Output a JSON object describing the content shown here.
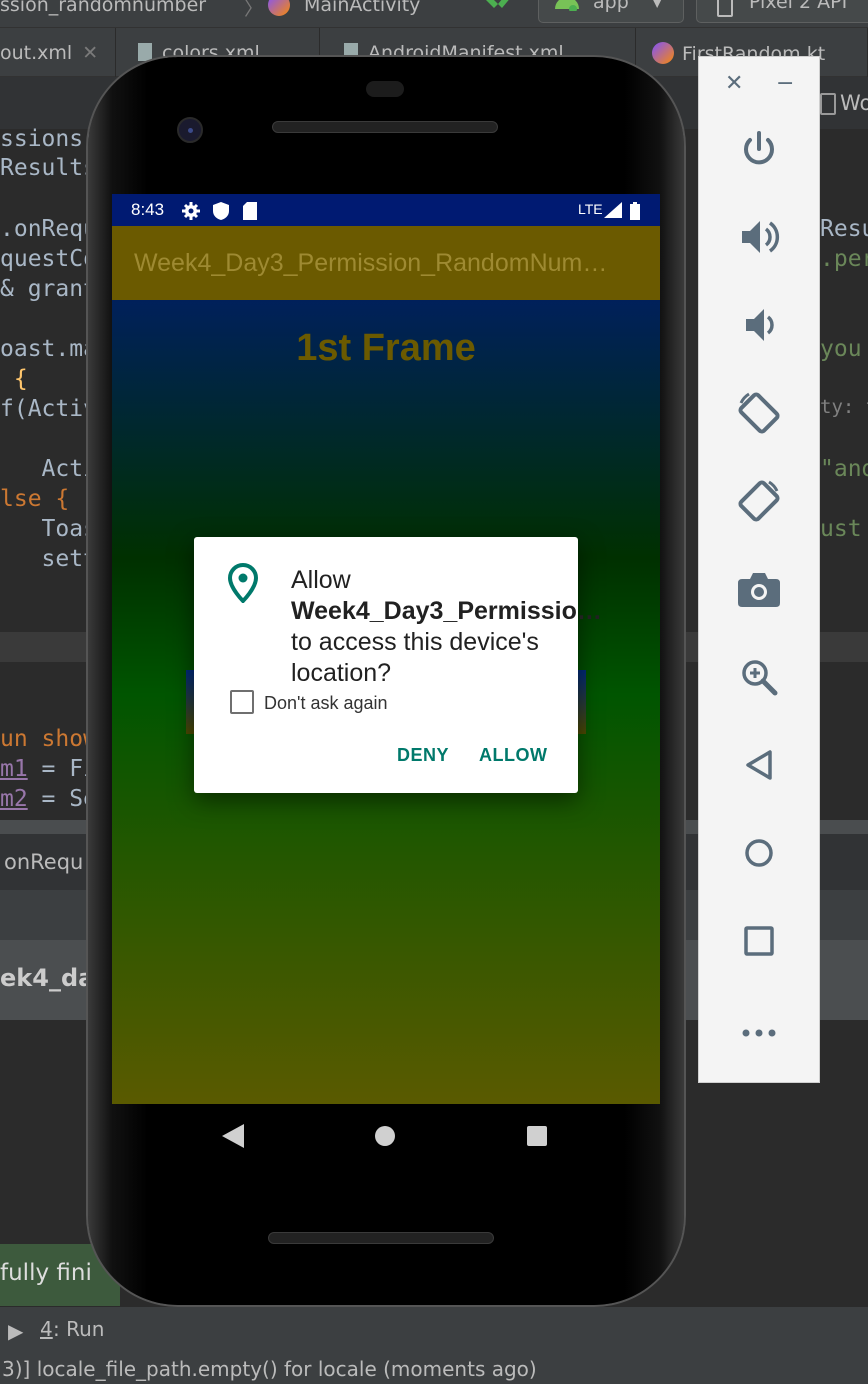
{
  "ide": {
    "breadcrumb_project": "ssion_randomnumber",
    "breadcrumb_class": "MainActivity",
    "run_config": "app",
    "device": "Pixel 2 API",
    "tabs": [
      "out.xml",
      "colors.xml",
      "AndroidManifest.xml",
      "FirstRandom.kt"
    ],
    "right_tab_label": "Wo",
    "code_left": [
      "ssions:",
      "Results",
      ".onRequ",
      "questCo",
      "& grant",
      "oast.ma",
      " {",
      "f(Activ",
      "   Acti",
      "lse {",
      "   Toas",
      "   sett"
    ],
    "code_right": [
      "Resu",
      ".per",
      "you",
      "ty: t",
      "\"and",
      "ust"
    ],
    "fun_line": "un show",
    "assign_1_var": "m1",
    "assign_1_rest": " = Fi",
    "assign_2_var": "m2",
    "assign_2_rest": " = Se",
    "breadcrumb_bottom": "onRequ",
    "panel_title": "ek4_da",
    "build_msg": "fully fini",
    "run_tab_num": "4",
    "run_tab_label": ": Run",
    "status_message": "3)] locale_file_path.empty() for locale (moments ago)"
  },
  "phone": {
    "status_time": "8:43",
    "network": "LTE",
    "app_title": "Week4_Day3_Permission_RandomNum…",
    "frame_title": "1st Frame",
    "dialog": {
      "message_prefix": "Allow ",
      "app_name": "Week4_Day3_Permissio…",
      "message_suffix": " to access this device's location?",
      "checkbox_label": "Don't ask again",
      "checkbox_checked": false,
      "deny_label": "DENY",
      "allow_label": "ALLOW",
      "accent_color": "#00796b"
    }
  },
  "emulator_panel": {
    "buttons": [
      "power-icon",
      "volume-up-icon",
      "volume-down-icon",
      "rotate-left-icon",
      "rotate-right-icon",
      "camera-icon",
      "zoom-icon",
      "back-icon",
      "home-icon",
      "overview-icon",
      "more-icon"
    ]
  }
}
